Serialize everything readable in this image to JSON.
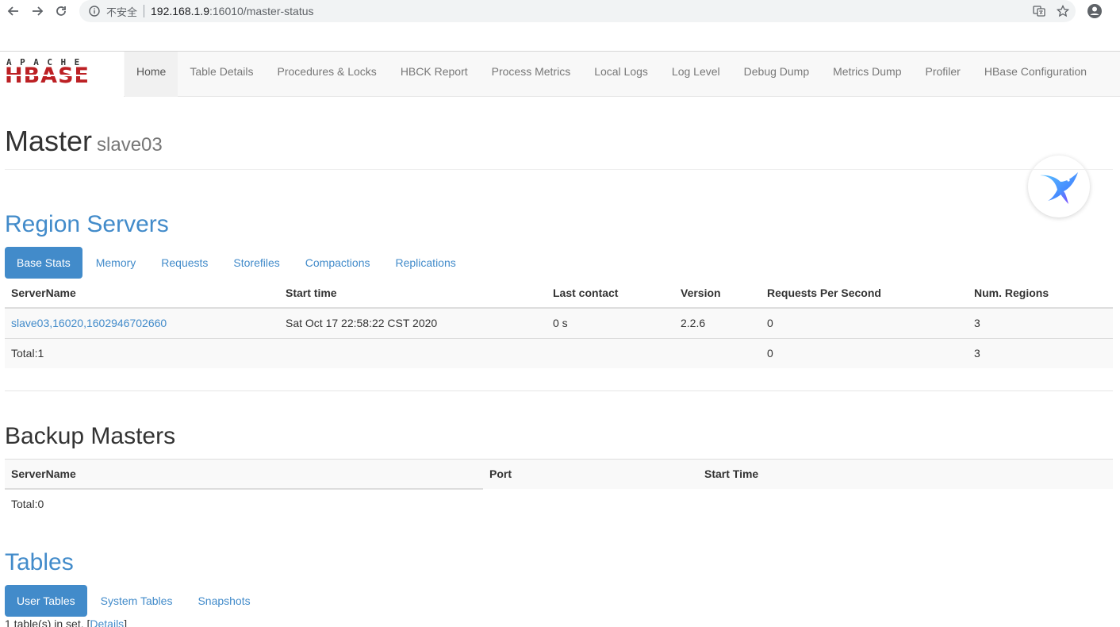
{
  "browser": {
    "insecure_label": "不安全",
    "url_host": "192.168.1.9",
    "url_path": ":16010/master-status"
  },
  "logo": {
    "apache": "APACHE",
    "hbase": "HBASE"
  },
  "nav": [
    {
      "label": "Home",
      "active": true
    },
    {
      "label": "Table Details"
    },
    {
      "label": "Procedures & Locks"
    },
    {
      "label": "HBCK Report"
    },
    {
      "label": "Process Metrics"
    },
    {
      "label": "Local Logs"
    },
    {
      "label": "Log Level"
    },
    {
      "label": "Debug Dump"
    },
    {
      "label": "Metrics Dump"
    },
    {
      "label": "Profiler"
    },
    {
      "label": "HBase Configuration"
    }
  ],
  "header": {
    "title": "Master",
    "host": "slave03"
  },
  "region_servers": {
    "title": "Region Servers",
    "tabs": [
      "Base Stats",
      "Memory",
      "Requests",
      "Storefiles",
      "Compactions",
      "Replications"
    ],
    "columns": [
      "ServerName",
      "Start time",
      "Last contact",
      "Version",
      "Requests Per Second",
      "Num. Regions"
    ],
    "rows": [
      {
        "server": "slave03,16020,1602946702660",
        "start_time": "Sat Oct 17 22:58:22 CST 2020",
        "last_contact": "0 s",
        "version": "2.2.6",
        "rps": "0",
        "regions": "3"
      }
    ],
    "total": {
      "label": "Total:1",
      "rps": "0",
      "regions": "3"
    }
  },
  "backup_masters": {
    "title": "Backup Masters",
    "columns": [
      "ServerName",
      "Port",
      "Start Time"
    ],
    "total": "Total:0"
  },
  "tables": {
    "title": "Tables",
    "tabs": [
      "User Tables",
      "System Tables",
      "Snapshots"
    ],
    "summary": "1 table(s) in set. [",
    "details_link": "Details",
    "summary_end": "]"
  }
}
